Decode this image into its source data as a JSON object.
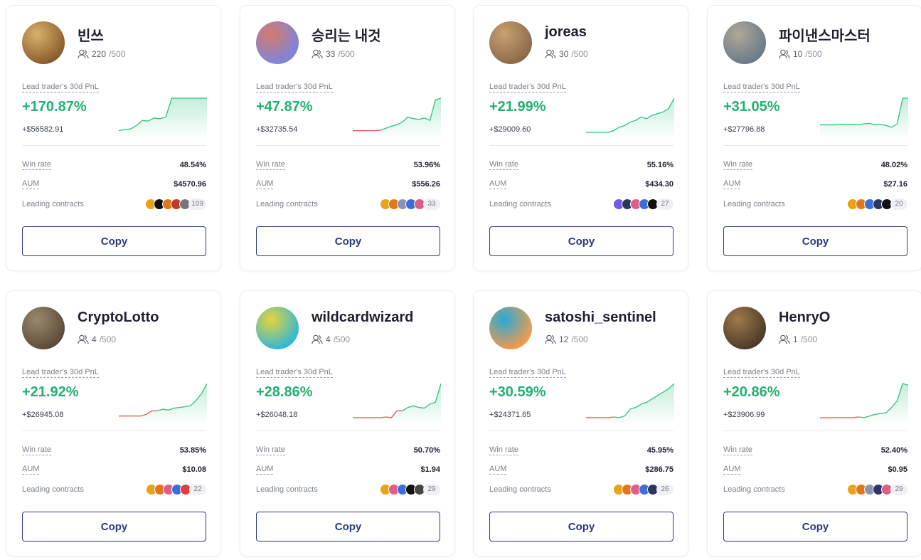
{
  "labels": {
    "pnl_label": "Lead trader's 30d PnL",
    "win_rate": "Win rate",
    "aum": "AUM",
    "leading_contracts": "Leading contracts",
    "copy": "Copy"
  },
  "traders": [
    {
      "name": "빈쓰",
      "followers": "220",
      "max": "/500",
      "pnl_pct": "+170.87%",
      "pnl_usd": "+$56582.91",
      "win_rate": "48.54%",
      "aum": "$4570.96",
      "contracts_more": "109",
      "avatar_colors": [
        "#8a5a2e",
        "#d8b26a"
      ],
      "coin_colors": [
        "#e9a316",
        "#111111",
        "#e2761b",
        "#c0392b",
        "#777777"
      ],
      "spark": [
        0.05,
        0.08,
        0.1,
        0.2,
        0.35,
        0.33,
        0.42,
        0.4,
        0.45,
        1,
        1,
        1,
        1,
        1,
        1,
        1
      ],
      "neg_until": 0
    },
    {
      "name": "승리는 내것",
      "followers": "33",
      "max": "/500",
      "pnl_pct": "+47.87%",
      "pnl_usd": "+$32735.54",
      "win_rate": "53.96%",
      "aum": "$556.26",
      "contracts_more": "33",
      "avatar_colors": [
        "#7c84e0",
        "#d67a6a"
      ],
      "coin_colors": [
        "#e9a316",
        "#e2761b",
        "#8a93b2",
        "#3b6fd8",
        "#e05d8a"
      ],
      "spark": [
        0.05,
        0.05,
        0.05,
        0.05,
        0.05,
        0.06,
        0.12,
        0.18,
        0.22,
        0.3,
        0.45,
        0.4,
        0.38,
        0.42,
        0.35,
        0.95,
        1
      ],
      "neg_until": 5
    },
    {
      "name": "joreas",
      "followers": "30",
      "max": "/500",
      "pnl_pct": "+21.99%",
      "pnl_usd": "+$29009.60",
      "win_rate": "55.16%",
      "aum": "$434.30",
      "contracts_more": "27",
      "avatar_colors": [
        "#8a6a4a",
        "#c9a070"
      ],
      "coin_colors": [
        "#6c5ce7",
        "#2d3561",
        "#e05d8a",
        "#3b6fd8",
        "#111111"
      ],
      "spark": [
        0.0,
        0.0,
        0.0,
        0.0,
        0.0,
        0.05,
        0.15,
        0.2,
        0.3,
        0.35,
        0.45,
        0.4,
        0.5,
        0.55,
        0.6,
        0.7,
        1
      ],
      "neg_until": 0
    },
    {
      "name": "파이낸스마스터",
      "followers": "10",
      "max": "/500",
      "pnl_pct": "+31.05%",
      "pnl_usd": "+$27796.88",
      "win_rate": "48.02%",
      "aum": "$27.16",
      "contracts_more": "20",
      "avatar_colors": [
        "#6a7a8a",
        "#b0a898"
      ],
      "coin_colors": [
        "#e9a316",
        "#e2761b",
        "#3b6fd8",
        "#2d3561",
        "#111111"
      ],
      "spark": [
        0.22,
        0.22,
        0.22,
        0.22,
        0.24,
        0.22,
        0.23,
        0.22,
        0.25,
        0.26,
        0.22,
        0.24,
        0.2,
        0.15,
        0.25,
        1,
        1
      ],
      "neg_until": 0
    },
    {
      "name": "CryptoLotto",
      "followers": "4",
      "max": "/500",
      "pnl_pct": "+21.92%",
      "pnl_usd": "+$26945.08",
      "win_rate": "53.85%",
      "aum": "$10.08",
      "contracts_more": "22",
      "avatar_colors": [
        "#5a4a3a",
        "#9a8a6a"
      ],
      "coin_colors": [
        "#e9a316",
        "#e2761b",
        "#e05d8a",
        "#3b6fd8",
        "#e23b3b"
      ],
      "spark": [
        0.05,
        0.05,
        0.05,
        0.05,
        0.05,
        0.1,
        0.2,
        0.2,
        0.25,
        0.22,
        0.28,
        0.3,
        0.32,
        0.35,
        0.5,
        0.7,
        1
      ],
      "neg_until": 7
    },
    {
      "name": "wildcardwizard",
      "followers": "4",
      "max": "/500",
      "pnl_pct": "+28.86%",
      "pnl_usd": "+$26048.18",
      "win_rate": "50.70%",
      "aum": "$1.94",
      "contracts_more": "29",
      "avatar_colors": [
        "#2fb8d8",
        "#e8d23a"
      ],
      "coin_colors": [
        "#e9a316",
        "#e05d8a",
        "#3b6fd8",
        "#111111",
        "#444444"
      ],
      "spark": [
        0.0,
        0.0,
        0.0,
        0.0,
        0.0,
        0.0,
        0.02,
        0.0,
        0.2,
        0.2,
        0.3,
        0.35,
        0.3,
        0.28,
        0.4,
        0.45,
        1
      ],
      "neg_until": 9
    },
    {
      "name": "satoshi_sentinel",
      "followers": "12",
      "max": "/500",
      "pnl_pct": "+30.59%",
      "pnl_usd": "+$24371.65",
      "win_rate": "45.95%",
      "aum": "$286.75",
      "contracts_more": "26",
      "avatar_colors": [
        "#f59a4a",
        "#28a9d8"
      ],
      "coin_colors": [
        "#e9a316",
        "#e2761b",
        "#e05d8a",
        "#3b6fd8",
        "#2d3561"
      ],
      "spark": [
        0.0,
        0.0,
        0.0,
        0.0,
        0.0,
        0.02,
        0.0,
        0.05,
        0.25,
        0.3,
        0.4,
        0.45,
        0.55,
        0.65,
        0.75,
        0.85,
        1
      ],
      "neg_until": 5
    },
    {
      "name": "HenryO",
      "followers": "1",
      "max": "/500",
      "pnl_pct": "+20.86%",
      "pnl_usd": "+$23906.99",
      "win_rate": "52.40%",
      "aum": "$0.95",
      "contracts_more": "29",
      "avatar_colors": [
        "#4a3a2a",
        "#a07a4a"
      ],
      "coin_colors": [
        "#e9a316",
        "#e2761b",
        "#8a93b2",
        "#2d3561",
        "#e05d8a"
      ],
      "spark": [
        0.0,
        0.0,
        0.0,
        0.0,
        0.0,
        0.0,
        0.0,
        0.02,
        0.0,
        0.05,
        0.1,
        0.12,
        0.15,
        0.3,
        0.5,
        1,
        0.95
      ],
      "neg_until": 7
    }
  ]
}
